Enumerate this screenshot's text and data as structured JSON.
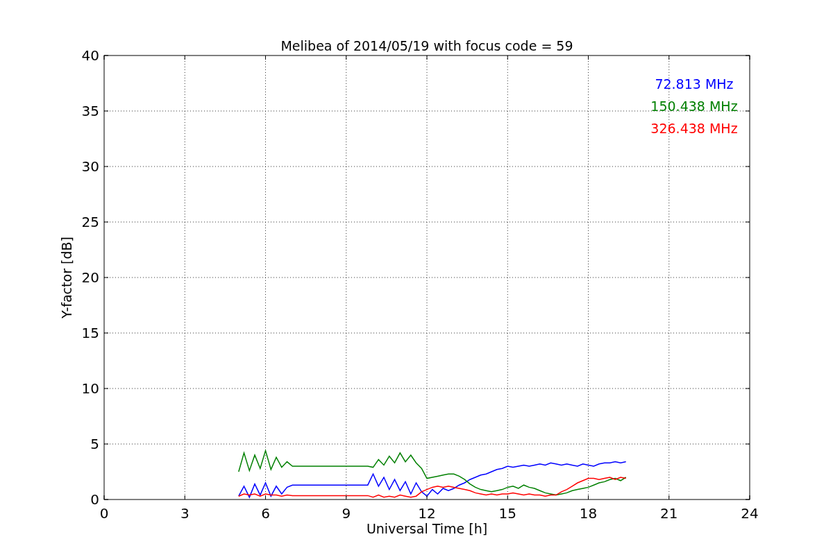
{
  "chart_data": {
    "type": "line",
    "title": "Melibea of 2014/05/19 with focus code = 59",
    "xlabel": "Universal Time [h]",
    "ylabel": "Y-factor [dB]",
    "x": [
      5,
      5.2,
      5.4,
      5.6,
      5.8,
      6,
      6.2,
      6.4,
      6.6,
      6.8,
      7,
      7.2,
      7.4,
      7.6,
      7.8,
      8,
      8.2,
      8.4,
      8.6,
      8.8,
      9,
      9.2,
      9.4,
      9.6,
      9.8,
      10,
      10.2,
      10.4,
      10.6,
      10.8,
      11,
      11.2,
      11.4,
      11.6,
      11.8,
      12,
      12.2,
      12.4,
      12.6,
      12.8,
      13,
      13.2,
      13.4,
      13.6,
      13.8,
      14,
      14.2,
      14.4,
      14.6,
      14.8,
      15,
      15.2,
      15.4,
      15.6,
      15.8,
      16,
      16.2,
      16.4,
      16.6,
      16.8,
      17,
      17.2,
      17.4,
      17.6,
      17.8,
      18,
      18.2,
      18.4,
      18.6,
      18.8,
      19,
      19.2,
      19.4
    ],
    "series": [
      {
        "name": "72.813 MHz",
        "color": "#0000ff",
        "values": [
          0.3,
          1.2,
          0.2,
          1.4,
          0.4,
          1.5,
          0.3,
          1.2,
          0.5,
          1.1,
          1.3,
          1.3,
          1.3,
          1.3,
          1.3,
          1.3,
          1.3,
          1.3,
          1.3,
          1.3,
          1.3,
          1.3,
          1.3,
          1.3,
          1.3,
          2.3,
          1.2,
          2.0,
          0.9,
          1.8,
          0.8,
          1.6,
          0.5,
          1.5,
          0.7,
          0.3,
          0.9,
          0.5,
          1.0,
          0.8,
          1.0,
          1.3,
          1.5,
          1.8,
          2.0,
          2.2,
          2.3,
          2.5,
          2.7,
          2.8,
          3.0,
          2.9,
          3.0,
          3.1,
          3.0,
          3.1,
          3.2,
          3.1,
          3.3,
          3.2,
          3.1,
          3.2,
          3.1,
          3.0,
          3.2,
          3.1,
          3.0,
          3.2,
          3.3,
          3.3,
          3.4,
          3.3,
          3.4
        ]
      },
      {
        "name": "150.438 MHz",
        "color": "#008000",
        "values": [
          2.5,
          4.2,
          2.6,
          4.0,
          2.8,
          4.4,
          2.7,
          3.8,
          2.9,
          3.4,
          3.0,
          3.0,
          3.0,
          3.0,
          3.0,
          3.0,
          3.0,
          3.0,
          3.0,
          3.0,
          3.0,
          3.0,
          3.0,
          3.0,
          3.0,
          2.9,
          3.6,
          3.1,
          3.9,
          3.3,
          4.2,
          3.4,
          4.0,
          3.3,
          2.8,
          1.9,
          2.0,
          2.1,
          2.2,
          2.3,
          2.3,
          2.1,
          1.8,
          1.4,
          1.1,
          0.9,
          0.8,
          0.7,
          0.8,
          0.9,
          1.1,
          1.2,
          1.0,
          1.3,
          1.1,
          1.0,
          0.8,
          0.6,
          0.5,
          0.4,
          0.5,
          0.6,
          0.8,
          0.9,
          1.0,
          1.1,
          1.3,
          1.5,
          1.6,
          1.8,
          1.9,
          1.7,
          2.0
        ]
      },
      {
        "name": "326.438 MHz",
        "color": "#ff0000",
        "values": [
          0.3,
          0.5,
          0.4,
          0.5,
          0.3,
          0.5,
          0.4,
          0.4,
          0.3,
          0.4,
          0.35,
          0.35,
          0.35,
          0.35,
          0.35,
          0.35,
          0.35,
          0.35,
          0.35,
          0.35,
          0.35,
          0.35,
          0.35,
          0.35,
          0.35,
          0.2,
          0.4,
          0.2,
          0.3,
          0.2,
          0.4,
          0.3,
          0.2,
          0.3,
          0.7,
          0.9,
          1.1,
          1.2,
          1.1,
          1.2,
          1.1,
          1.0,
          0.9,
          0.8,
          0.6,
          0.5,
          0.4,
          0.5,
          0.4,
          0.5,
          0.5,
          0.6,
          0.5,
          0.4,
          0.5,
          0.4,
          0.4,
          0.3,
          0.4,
          0.4,
          0.7,
          0.9,
          1.2,
          1.5,
          1.7,
          1.9,
          1.9,
          1.8,
          1.9,
          2.0,
          1.8,
          2.0,
          1.9
        ]
      }
    ],
    "grid": true,
    "xlim": [
      0,
      24
    ],
    "ylim": [
      0,
      40
    ],
    "xticks": [
      0,
      3,
      6,
      9,
      12,
      15,
      18,
      21,
      24
    ],
    "yticks": [
      0,
      5,
      10,
      15,
      20,
      25,
      30,
      35,
      40
    ]
  }
}
